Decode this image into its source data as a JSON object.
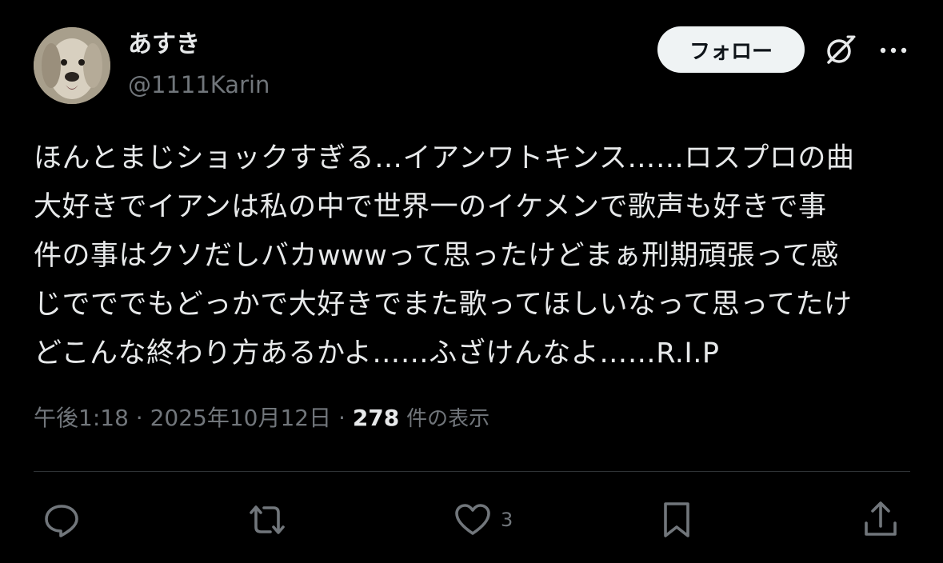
{
  "author": {
    "display_name": "あすき",
    "handle": "@1111Karin",
    "avatar_icon": "dog-avatar"
  },
  "header": {
    "follow_label": "フォロー",
    "grok_icon": "grok-icon",
    "more_icon": "more-icon"
  },
  "tweet": {
    "lines": [
      "ほんとまじショックすぎる…イアンワトキンス……ロスプロの曲",
      "大好きでイアンは私の中で世界一のイケメンで歌声も好きで事",
      "件の事はクソだしバカwwwって思ったけどまぁ刑期頑張って感",
      "じでででもどっかで大好きでまた歌ってほしいなって思ってたけ",
      "どこんな終わり方あるかよ……ふざけんなよ……R.I.P"
    ]
  },
  "meta": {
    "timestamp": "午後1:18 · 2025年10月12日 ·",
    "views_count": "278",
    "views_label": "件の表示"
  },
  "actions": {
    "reply_icon": "reply-icon",
    "repost_icon": "repost-icon",
    "like_icon": "heart-icon",
    "like_count": "3",
    "bookmark_icon": "bookmark-icon",
    "share_icon": "share-icon"
  },
  "colors": {
    "background": "#000000",
    "text_primary": "#e7e9ea",
    "text_secondary": "#71767b",
    "follow_button_bg": "#eff3f4",
    "divider": "#2f3336"
  }
}
